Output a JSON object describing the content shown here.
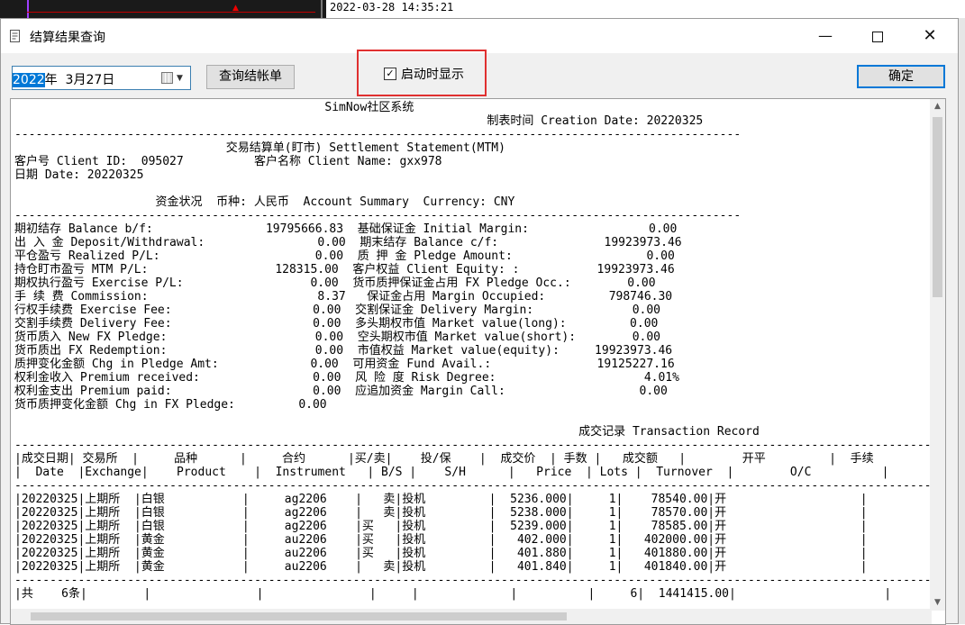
{
  "background": {
    "timestamp": "2022-03-28 14:35:21"
  },
  "window": {
    "title": "结算结果查询",
    "minimize": "—",
    "close": "✕"
  },
  "toolbar": {
    "date_year_selected": "2022",
    "date_rest": "年  3月27日",
    "query_button": "查询结帐单",
    "show_on_start_label": "启动时显示",
    "show_on_start_checked": "✓",
    "ok_button": "确定"
  },
  "report": {
    "lines": [
      "                                            SimNow社区系统",
      "                                                                   制表时间 Creation Date: 20220325",
      "-------------------------------------------------------------------------------------------------------",
      "                              交易结算单(盯市) Settlement Statement(MTM)",
      "客户号 Client ID:  095027          客户名称 Client Name: gxx978",
      "日期 Date: 20220325",
      "",
      "                    资金状况  币种: 人民币  Account Summary  Currency: CNY",
      "-------------------------------------------------------------------------------------------------------",
      "期初结存 Balance b/f:                19795666.83  基础保证金 Initial Margin:                 0.00",
      "出 入 金 Deposit/Withdrawal:                0.00  期末结存 Balance c/f:               19923973.46",
      "平仓盈亏 Realized P/L:                      0.00  质 押 金 Pledge Amount:                   0.00",
      "持仓盯市盈亏 MTM P/L:                  128315.00  客户权益 Client Equity: :           19923973.46",
      "期权执行盈亏 Exercise P/L:                  0.00  货币质押保证金占用 FX Pledge Occ.:        0.00",
      "手 续 费 Commission:                        8.37   保证金占用 Margin Occupied:         798746.30",
      "行权手续费 Exercise Fee:                    0.00  交割保证金 Delivery Margin:              0.00",
      "交割手续费 Delivery Fee:                    0.00  多头期权市值 Market value(long):         0.00",
      "货币质入 New FX Pledge:                     0.00  空头期权市值 Market value(short):        0.00",
      "货币质出 FX Redemption:                     0.00  市值权益 Market value(equity):     19923973.46",
      "质押变化金额 Chg in Pledge Amt:             0.00  可用资金 Fund Avail.:               19125227.16",
      "权利金收入 Premium received:                0.00  风 险 度 Risk Degree:                     4.01%",
      "权利金支出 Premium paid:                    0.00  应追加资金 Margin Call:                   0.00",
      "货币质押变化金额 Chg in FX Pledge:         0.00",
      "",
      "                                                                                成交记录 Transaction Record",
      "----------------------------------------------------------------------------------------------------------------------------------",
      "|成交日期| 交易所  |     品种      |     合约      |买/卖|    投/保    |  成交价  | 手数 |   成交额   |        开平         |  手续",
      "|  Date  |Exchange|    Product    |  Instrument   | B/S |    S/H      |   Price  | Lots |  Turnover  |        O/C          |",
      "----------------------------------------------------------------------------------------------------------------------------------",
      "|20220325|上期所  |白银           |     ag2206    |   卖|投机         |  5236.000|     1|    78540.00|开                   |",
      "|20220325|上期所  |白银           |     ag2206    |   卖|投机         |  5238.000|     1|    78570.00|开                   |",
      "|20220325|上期所  |白银           |     ag2206    |买   |投机         |  5239.000|     1|    78585.00|开                   |",
      "|20220325|上期所  |黄金           |     au2206    |买   |投机         |   402.000|     1|   402000.00|开                   |",
      "|20220325|上期所  |黄金           |     au2206    |买   |投机         |   401.880|     1|   401880.00|开                   |",
      "|20220325|上期所  |黄金           |     au2206    |   卖|投机         |   401.840|     1|   401840.00|开                   |",
      "----------------------------------------------------------------------------------------------------------------------------------",
      "|共    6条|        |               |               |     |             |          |     6|  1441415.00|                     |"
    ]
  }
}
